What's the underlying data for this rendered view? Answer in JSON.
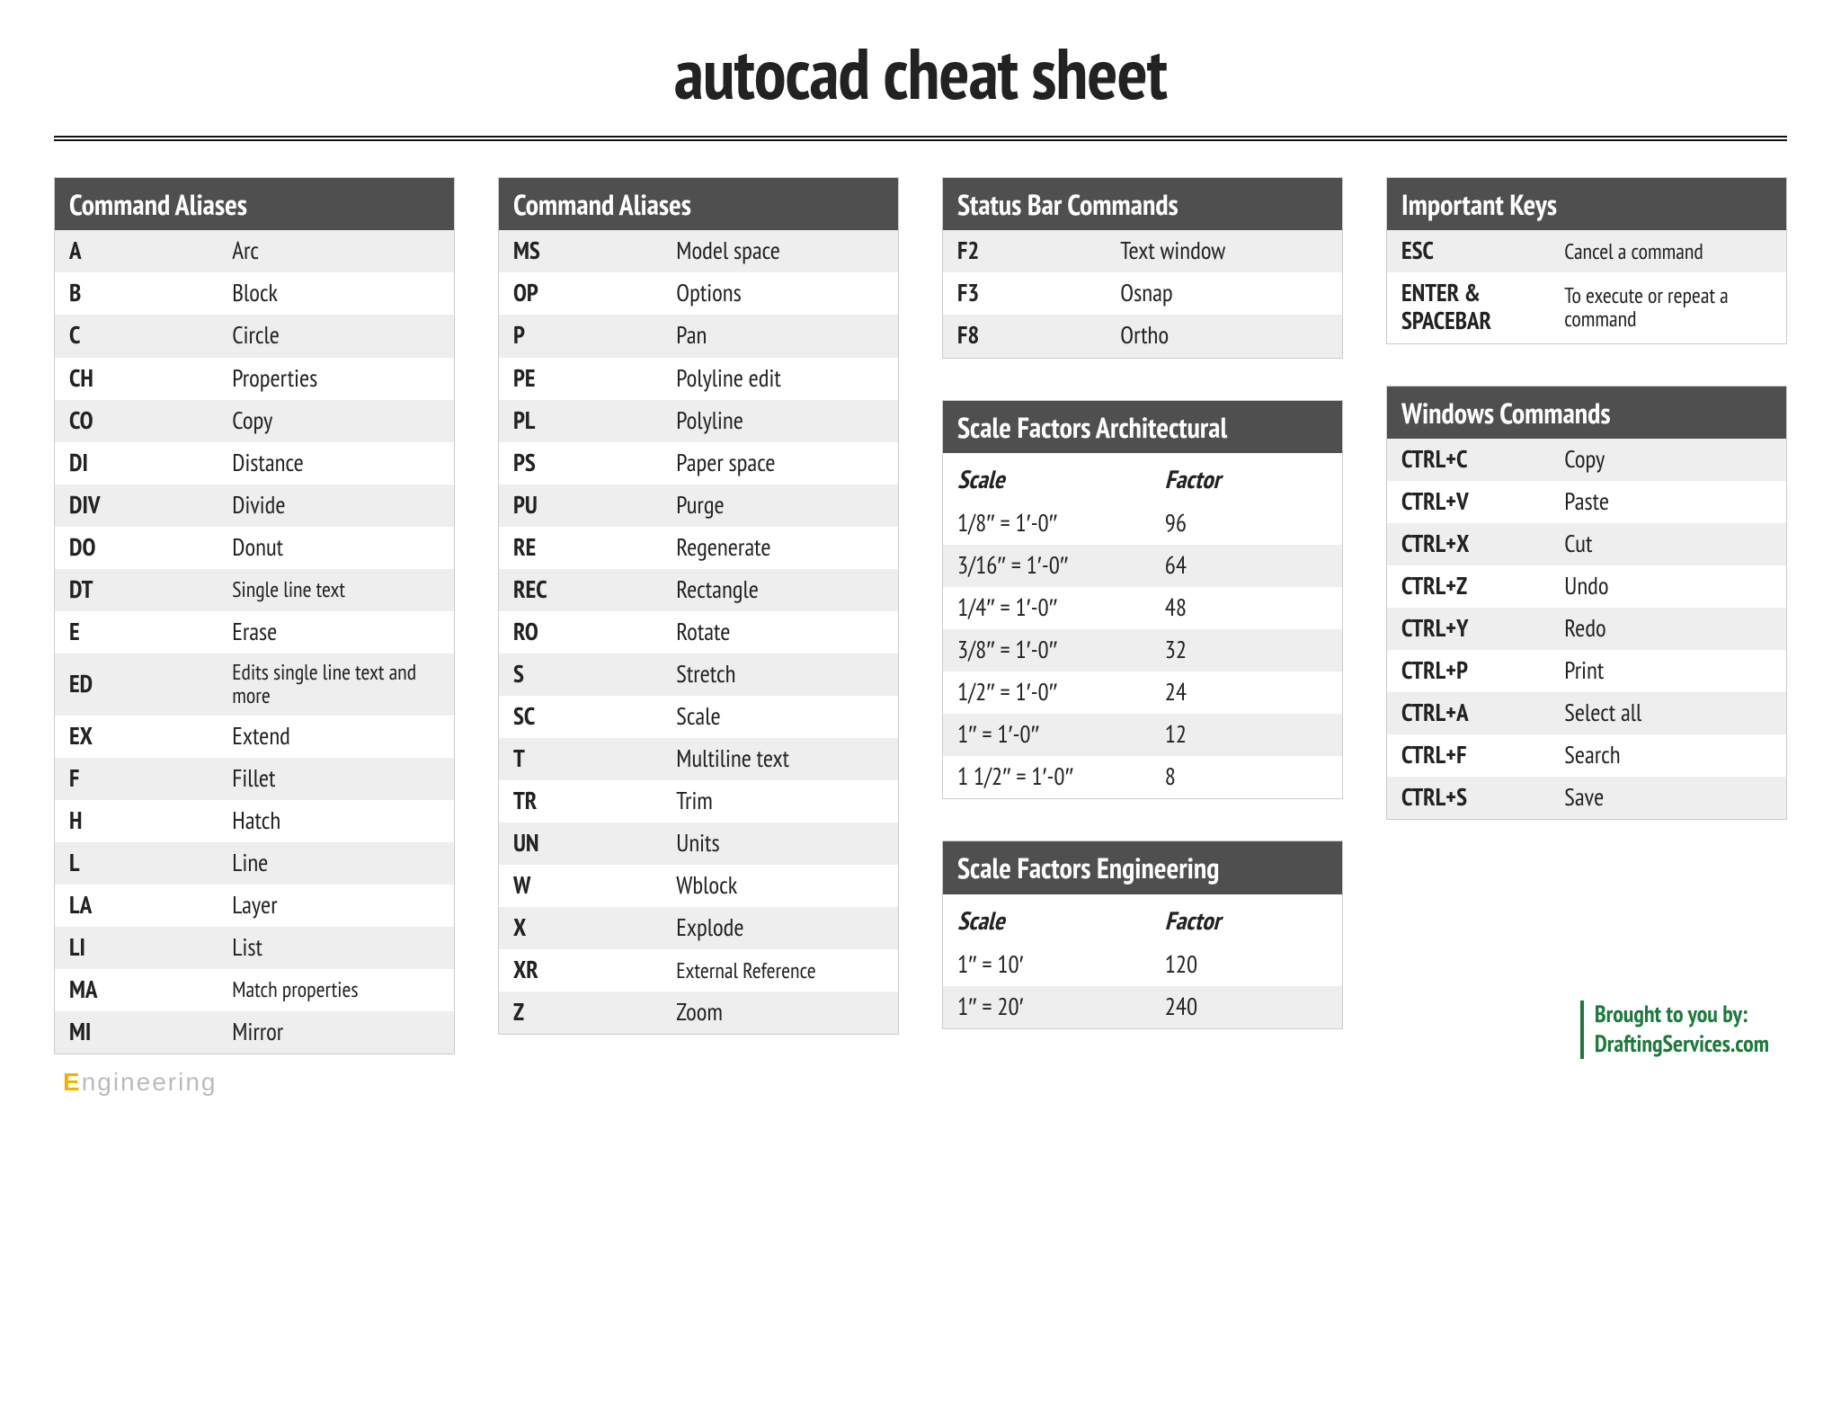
{
  "title": "autocad cheat sheet",
  "footer": {
    "line1": "Brought to you by:",
    "line2": "DraftingServices.com"
  },
  "watermark": {
    "part1": "E",
    "part2": "ngineering"
  },
  "cols": [
    [
      {
        "id": "aliases1",
        "title": "Command Aliases",
        "type": "kv",
        "rows": [
          {
            "k": "A",
            "v": "Arc"
          },
          {
            "k": "B",
            "v": "Block"
          },
          {
            "k": "C",
            "v": "Circle"
          },
          {
            "k": "CH",
            "v": "Properties"
          },
          {
            "k": "CO",
            "v": "Copy"
          },
          {
            "k": "DI",
            "v": "Distance"
          },
          {
            "k": "DIV",
            "v": "Divide"
          },
          {
            "k": "DO",
            "v": "Donut"
          },
          {
            "k": "DT",
            "v": "Single line text",
            "small": true
          },
          {
            "k": "E",
            "v": "Erase"
          },
          {
            "k": "ED",
            "v": "Edits single line text and more",
            "small": true
          },
          {
            "k": "EX",
            "v": "Extend"
          },
          {
            "k": "F",
            "v": "Fillet"
          },
          {
            "k": "H",
            "v": "Hatch"
          },
          {
            "k": "L",
            "v": "Line"
          },
          {
            "k": "LA",
            "v": "Layer"
          },
          {
            "k": "LI",
            "v": "List"
          },
          {
            "k": "MA",
            "v": "Match properties",
            "small": true
          },
          {
            "k": "MI",
            "v": "Mirror"
          }
        ]
      }
    ],
    [
      {
        "id": "aliases2",
        "title": "Command Aliases",
        "type": "kv",
        "rows": [
          {
            "k": "MS",
            "v": "Model space"
          },
          {
            "k": "OP",
            "v": "Options"
          },
          {
            "k": "P",
            "v": "Pan"
          },
          {
            "k": "PE",
            "v": "Polyline edit"
          },
          {
            "k": "PL",
            "v": "Polyline"
          },
          {
            "k": "PS",
            "v": "Paper space"
          },
          {
            "k": "PU",
            "v": "Purge"
          },
          {
            "k": "RE",
            "v": "Regenerate"
          },
          {
            "k": "REC",
            "v": "Rectangle"
          },
          {
            "k": "RO",
            "v": "Rotate"
          },
          {
            "k": "S",
            "v": "Stretch"
          },
          {
            "k": "SC",
            "v": "Scale"
          },
          {
            "k": "T",
            "v": "Multiline text"
          },
          {
            "k": "TR",
            "v": "Trim"
          },
          {
            "k": "UN",
            "v": "Units"
          },
          {
            "k": "W",
            "v": "Wblock"
          },
          {
            "k": "X",
            "v": "Explode"
          },
          {
            "k": "XR",
            "v": "External Reference",
            "small": true
          },
          {
            "k": "Z",
            "v": "Zoom"
          }
        ]
      }
    ],
    [
      {
        "id": "statusbar",
        "title": "Status Bar Commands",
        "type": "kv",
        "rows": [
          {
            "k": "F2",
            "v": "Text window"
          },
          {
            "k": "F3",
            "v": "Osnap"
          },
          {
            "k": "F8",
            "v": "Ortho"
          }
        ]
      },
      {
        "id": "scale-arch",
        "title": "Scale Factors Architectural",
        "type": "scale",
        "sub": {
          "k": "Scale",
          "v": "Factor"
        },
        "rows": [
          {
            "k": "1/8″ = 1′-0″",
            "v": "96"
          },
          {
            "k": "3/16″ = 1′-0″",
            "v": "64"
          },
          {
            "k": "1/4″ = 1′-0″",
            "v": "48"
          },
          {
            "k": "3/8″ = 1′-0″",
            "v": "32"
          },
          {
            "k": "1/2″ = 1′-0″",
            "v": "24"
          },
          {
            "k": "1″ = 1′-0″",
            "v": "12"
          },
          {
            "k": "1 1/2″ = 1′-0″",
            "v": "8"
          }
        ]
      },
      {
        "id": "scale-eng",
        "title": "Scale Factors Engineering",
        "type": "scale",
        "sub": {
          "k": "Scale",
          "v": "Factor"
        },
        "rows": [
          {
            "k": "1″ = 10′",
            "v": "120"
          },
          {
            "k": "1″ = 20′",
            "v": "240"
          }
        ]
      }
    ],
    [
      {
        "id": "important-keys",
        "title": "Important Keys",
        "type": "kv",
        "rows": [
          {
            "k": "ESC",
            "v": "Cancel a command",
            "small": true
          },
          {
            "k": "ENTER & SPACEBAR",
            "v": "To execute or repeat a command",
            "small": true
          }
        ]
      },
      {
        "id": "windows",
        "title": "Windows Commands",
        "type": "kv",
        "rows": [
          {
            "k": "CTRL+C",
            "v": "Copy"
          },
          {
            "k": "CTRL+V",
            "v": "Paste"
          },
          {
            "k": "CTRL+X",
            "v": "Cut"
          },
          {
            "k": "CTRL+Z",
            "v": "Undo"
          },
          {
            "k": "CTRL+Y",
            "v": "Redo"
          },
          {
            "k": "CTRL+P",
            "v": "Print"
          },
          {
            "k": "CTRL+A",
            "v": "Select all"
          },
          {
            "k": "CTRL+F",
            "v": "Search"
          },
          {
            "k": "CTRL+S",
            "v": "Save"
          }
        ]
      }
    ]
  ]
}
